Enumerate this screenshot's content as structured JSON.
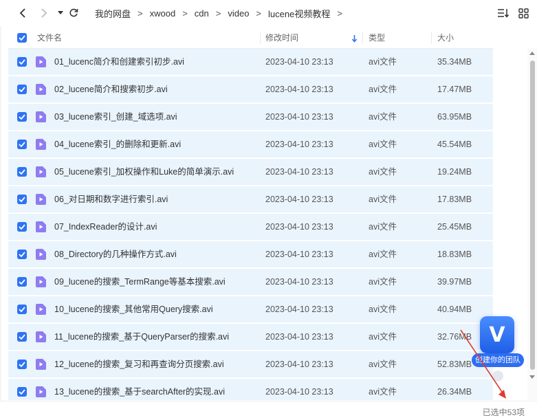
{
  "breadcrumb": [
    "我的网盘",
    "xwood",
    "cdn",
    "video",
    "lucene视频教程"
  ],
  "breadcrumb_separator": ">",
  "columns": {
    "name": "文件名",
    "modified": "修改时间",
    "type": "类型",
    "size": "大小"
  },
  "files": [
    {
      "name": "01_lucenc简介和创建索引初步.avi",
      "modified": "2023-04-10 23:13",
      "type": "avi文件",
      "size": "35.34MB"
    },
    {
      "name": "02_lucene简介和搜索初步.avi",
      "modified": "2023-04-10 23:13",
      "type": "avi文件",
      "size": "17.47MB"
    },
    {
      "name": "03_lucene索引_创建_域选项.avi",
      "modified": "2023-04-10 23:13",
      "type": "avi文件",
      "size": "63.95MB"
    },
    {
      "name": "04_lucene索引_的删除和更新.avi",
      "modified": "2023-04-10 23:13",
      "type": "avi文件",
      "size": "45.54MB"
    },
    {
      "name": "05_lucene索引_加权操作和Luke的简单演示.avi",
      "modified": "2023-04-10 23:13",
      "type": "avi文件",
      "size": "19.24MB"
    },
    {
      "name": "06_对日期和数字进行索引.avi",
      "modified": "2023-04-10 23:13",
      "type": "avi文件",
      "size": "17.83MB"
    },
    {
      "name": "07_IndexReader的设计.avi",
      "modified": "2023-04-10 23:13",
      "type": "avi文件",
      "size": "25.45MB"
    },
    {
      "name": "08_Directory的几种操作方式.avi",
      "modified": "2023-04-10 23:13",
      "type": "avi文件",
      "size": "18.83MB"
    },
    {
      "name": "09_lucene的搜索_TermRange等基本搜索.avi",
      "modified": "2023-04-10 23:13",
      "type": "avi文件",
      "size": "39.97MB"
    },
    {
      "name": "10_lucene的搜索_其他常用Query搜索.avi",
      "modified": "2023-04-10 23:13",
      "type": "avi文件",
      "size": "40.94MB"
    },
    {
      "name": "11_lucene的搜索_基于QueryParser的搜索.avi",
      "modified": "2023-04-10 23:13",
      "type": "avi文件",
      "size": "32.76MB"
    },
    {
      "name": "12_lucene的搜索_复习和再查询分页搜索.avi",
      "modified": "2023-04-10 23:13",
      "type": "avi文件",
      "size": "52.83MB"
    },
    {
      "name": "13_lucene的搜索_基于searchAfter的实现.avi",
      "modified": "2023-04-10 23:13",
      "type": "avi文件",
      "size": "26.34MB"
    }
  ],
  "status": "已选中53项",
  "promo": {
    "letter": "V",
    "label": "创建你的团队"
  },
  "colors": {
    "accent": "#2e73f3",
    "row_selected": "#eaf4fd",
    "file_icon": "#8e7cf0"
  }
}
